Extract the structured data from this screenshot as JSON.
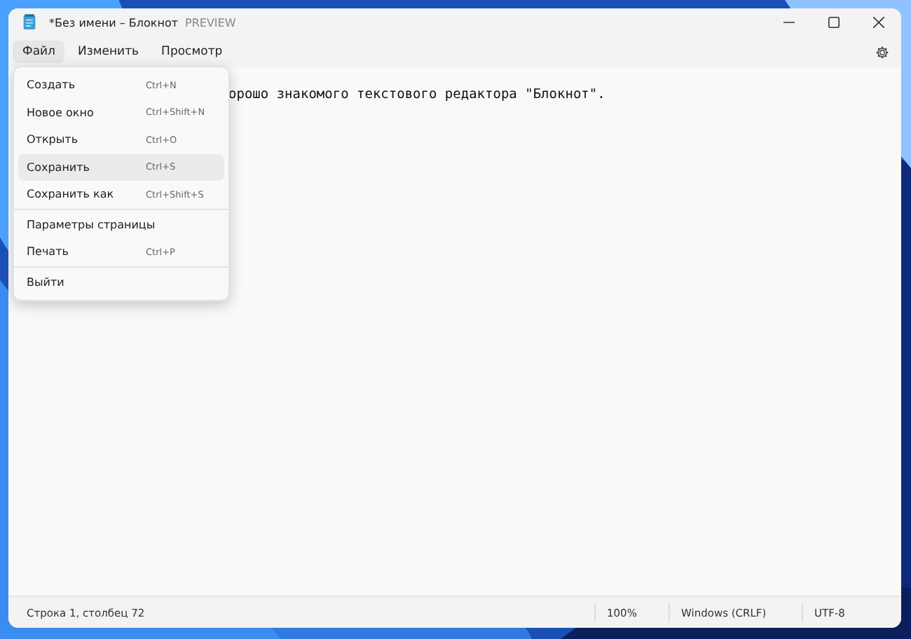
{
  "window": {
    "title": "*Без имени – Блокнот",
    "badge": "PREVIEW"
  },
  "menubar": [
    {
      "label": "Файл",
      "selected": true
    },
    {
      "label": "Изменить",
      "selected": false
    },
    {
      "label": "Просмотр",
      "selected": false
    }
  ],
  "file_menu": [
    {
      "label": "Создать",
      "shortcut": "Ctrl+N",
      "selected": false,
      "separator_after": false
    },
    {
      "label": "Новое окно",
      "shortcut": "Ctrl+Shift+N",
      "selected": false,
      "separator_after": false
    },
    {
      "label": "Открыть",
      "shortcut": "Ctrl+O",
      "selected": false,
      "separator_after": false
    },
    {
      "label": "Сохранить",
      "shortcut": "Ctrl+S",
      "selected": true,
      "separator_after": false
    },
    {
      "label": "Сохранить как",
      "shortcut": "Ctrl+Shift+S",
      "selected": false,
      "separator_after": true
    },
    {
      "label": "Параметры страницы",
      "selected": false,
      "separator_after": false
    },
    {
      "label": "Печать",
      "shortcut": "Ctrl+P",
      "selected": false,
      "separator_after": true
    },
    {
      "label": "Выйти",
      "selected": false,
      "separator_after": false
    }
  ],
  "editor": {
    "text": "орошо знакомого текстового редактора \"Блокнот\"."
  },
  "status_bar": {
    "position": "Строка 1, столбец 72",
    "zoom": "100%",
    "line_ending": "Windows (CRLF)",
    "encoding": "UTF-8"
  }
}
